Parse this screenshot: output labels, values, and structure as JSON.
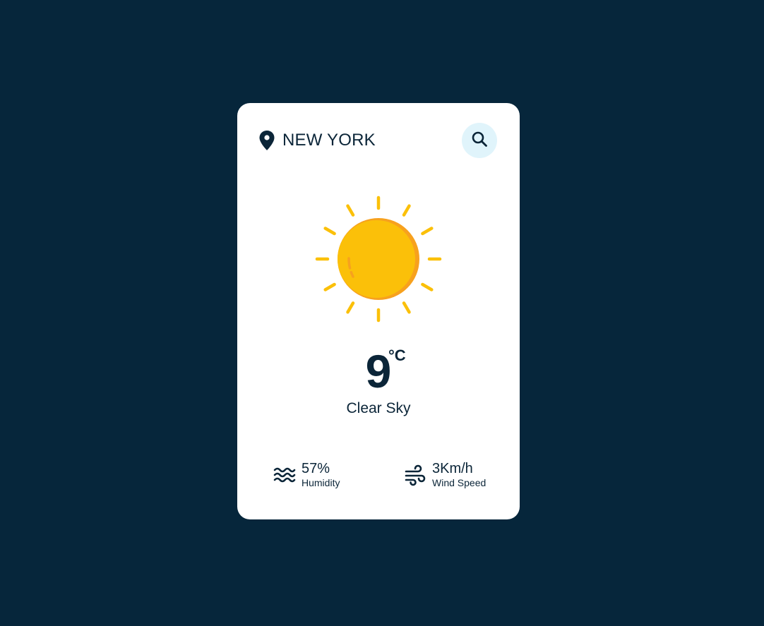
{
  "location": {
    "city": "NEW YORK",
    "icon": "map-pin-icon"
  },
  "search": {
    "icon": "search-icon"
  },
  "weather": {
    "icon": "sun-icon",
    "temperature": "9",
    "unit": "°C",
    "condition": "Clear Sky"
  },
  "stats": {
    "humidity": {
      "value": "57%",
      "label": "Humidity",
      "icon": "waves-icon"
    },
    "wind": {
      "value": "3Km/h",
      "label": "Wind Speed",
      "icon": "wind-icon"
    }
  },
  "colors": {
    "background": "#06263b",
    "card": "#ffffff",
    "text": "#0b2538",
    "search_bg": "#e0f4fb",
    "sun": "#fbc009",
    "sun_shade": "#f7a11e"
  }
}
